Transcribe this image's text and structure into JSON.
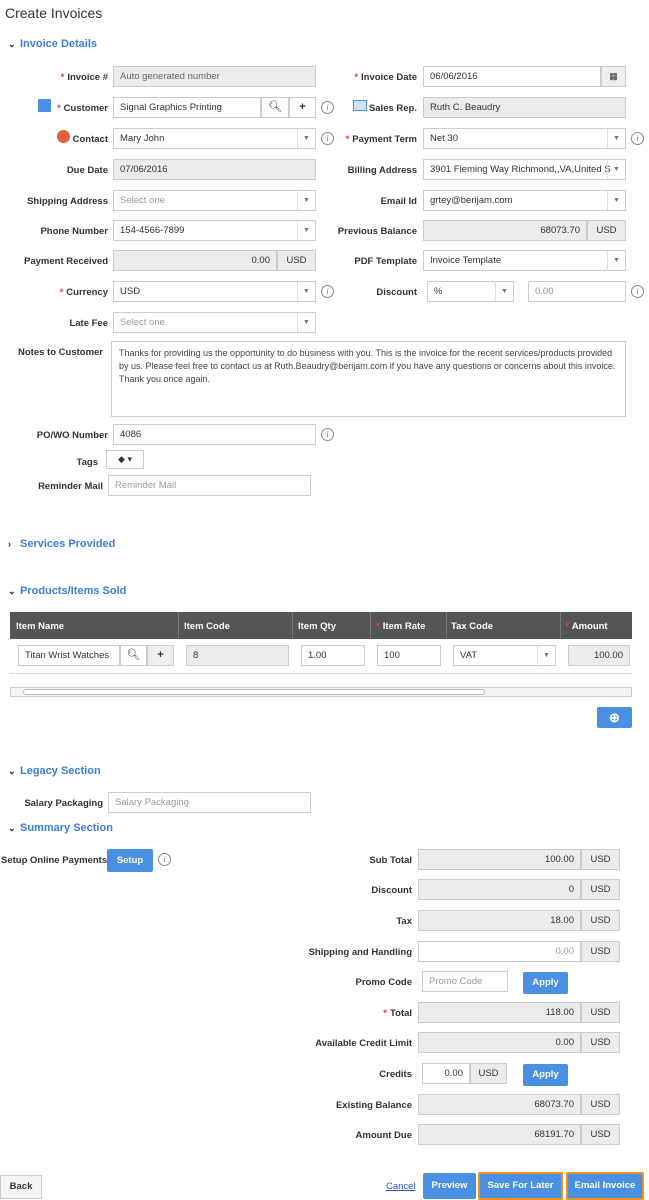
{
  "page_title": "Create Invoices",
  "sections": {
    "invoice_details": "Invoice Details",
    "services_provided": "Services Provided",
    "products_items": "Products/Items Sold",
    "legacy": "Legacy Section",
    "summary": "Summary Section"
  },
  "details": {
    "invoice_no_label": "Invoice #",
    "invoice_no_value": "Auto generated number",
    "invoice_date_label": "Invoice Date",
    "invoice_date_value": "06/06/2016",
    "customer_label": "Customer",
    "customer_value": "Signal Graphics Printing",
    "sales_rep_label": "Sales Rep.",
    "sales_rep_value": "Ruth C. Beaudry",
    "contact_label": "Contact",
    "contact_value": "Mary John",
    "payment_term_label": "Payment Term",
    "payment_term_value": "Net 30",
    "due_date_label": "Due Date",
    "due_date_value": "07/06/2016",
    "billing_address_label": "Billing Address",
    "billing_address_value": "3901 Fleming Way Richmond,,VA,United S",
    "shipping_address_label": "Shipping Address",
    "shipping_address_placeholder": "Select one",
    "email_label": "Email Id",
    "email_value": "grtey@berijam.com",
    "phone_label": "Phone Number",
    "phone_value": "154-4566-7899",
    "prev_balance_label": "Previous Balance",
    "prev_balance_value": "68073.70",
    "prev_balance_unit": "USD",
    "payment_received_label": "Payment Received",
    "payment_received_value": "0.00",
    "payment_received_unit": "USD",
    "pdf_template_label": "PDF Template",
    "pdf_template_value": "Invoice Template",
    "currency_label": "Currency",
    "currency_value": "USD",
    "discount_label": "Discount",
    "discount_type": "%",
    "discount_value": "0.00",
    "late_fee_label": "Late Fee",
    "late_fee_placeholder": "Select one",
    "notes_label": "Notes to Customer",
    "notes_value": "Thanks for providing us the opportunity to do business with you. This is the invoice for the recent services/products provided by us. Please feel free to contact us at Ruth.Beaudry@berijam.com if you have any questions or concerns about this invoice. Thank you once again.",
    "po_label": "PO/WO Number",
    "po_value": "4086",
    "tags_label": "Tags",
    "reminder_label": "Reminder Mail",
    "reminder_placeholder": "Reminder Mail"
  },
  "items_table": {
    "columns": [
      "Item Name",
      "Item Code",
      "Item Qty",
      "Item Rate",
      "Tax Code",
      "Amount"
    ],
    "row": {
      "name": "Titan Wrist Watches",
      "code": "8",
      "qty": "1.00",
      "rate": "100",
      "tax": "VAT",
      "amount": "100.00"
    }
  },
  "legacy": {
    "salary_label": "Salary Packaging",
    "salary_placeholder": "Salary Packaging"
  },
  "summary": {
    "setup_label": "Setup Online Payments",
    "setup_button": "Setup",
    "sub_total_label": "Sub Total",
    "sub_total": "100.00",
    "discount_label": "Discount",
    "discount": "0",
    "tax_label": "Tax",
    "tax": "18.00",
    "shipping_label": "Shipping and Handling",
    "shipping": "0.00",
    "promo_label": "Promo Code",
    "promo_placeholder": "Promo Code",
    "apply": "Apply",
    "total_label": "Total",
    "total": "118.00",
    "credit_limit_label": "Available Credit Limit",
    "credit_limit": "0.00",
    "credits_label": "Credits",
    "credits": "0.00",
    "existing_balance_label": "Existing Balance",
    "existing_balance": "68073.70",
    "amount_due_label": "Amount Due",
    "amount_due": "68191.70",
    "currency": "USD"
  },
  "footer": {
    "back": "Back",
    "cancel": "Cancel",
    "preview": "Preview",
    "save_later": "Save For Later",
    "email_invoice": "Email Invoice"
  },
  "colors": {
    "accent": "#3c7dd9",
    "button": "#4a90e2",
    "highlight": "#f0901a",
    "required": "#e53935"
  }
}
